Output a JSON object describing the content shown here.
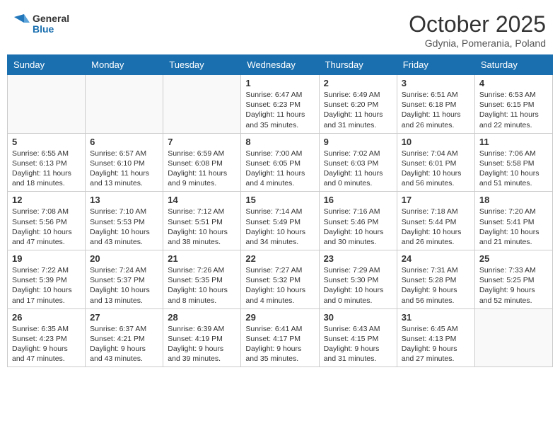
{
  "header": {
    "logo_general": "General",
    "logo_blue": "Blue",
    "month": "October 2025",
    "location": "Gdynia, Pomerania, Poland"
  },
  "weekdays": [
    "Sunday",
    "Monday",
    "Tuesday",
    "Wednesday",
    "Thursday",
    "Friday",
    "Saturday"
  ],
  "weeks": [
    [
      {
        "day": "",
        "info": ""
      },
      {
        "day": "",
        "info": ""
      },
      {
        "day": "",
        "info": ""
      },
      {
        "day": "1",
        "info": "Sunrise: 6:47 AM\nSunset: 6:23 PM\nDaylight: 11 hours\nand 35 minutes."
      },
      {
        "day": "2",
        "info": "Sunrise: 6:49 AM\nSunset: 6:20 PM\nDaylight: 11 hours\nand 31 minutes."
      },
      {
        "day": "3",
        "info": "Sunrise: 6:51 AM\nSunset: 6:18 PM\nDaylight: 11 hours\nand 26 minutes."
      },
      {
        "day": "4",
        "info": "Sunrise: 6:53 AM\nSunset: 6:15 PM\nDaylight: 11 hours\nand 22 minutes."
      }
    ],
    [
      {
        "day": "5",
        "info": "Sunrise: 6:55 AM\nSunset: 6:13 PM\nDaylight: 11 hours\nand 18 minutes."
      },
      {
        "day": "6",
        "info": "Sunrise: 6:57 AM\nSunset: 6:10 PM\nDaylight: 11 hours\nand 13 minutes."
      },
      {
        "day": "7",
        "info": "Sunrise: 6:59 AM\nSunset: 6:08 PM\nDaylight: 11 hours\nand 9 minutes."
      },
      {
        "day": "8",
        "info": "Sunrise: 7:00 AM\nSunset: 6:05 PM\nDaylight: 11 hours\nand 4 minutes."
      },
      {
        "day": "9",
        "info": "Sunrise: 7:02 AM\nSunset: 6:03 PM\nDaylight: 11 hours\nand 0 minutes."
      },
      {
        "day": "10",
        "info": "Sunrise: 7:04 AM\nSunset: 6:01 PM\nDaylight: 10 hours\nand 56 minutes."
      },
      {
        "day": "11",
        "info": "Sunrise: 7:06 AM\nSunset: 5:58 PM\nDaylight: 10 hours\nand 51 minutes."
      }
    ],
    [
      {
        "day": "12",
        "info": "Sunrise: 7:08 AM\nSunset: 5:56 PM\nDaylight: 10 hours\nand 47 minutes."
      },
      {
        "day": "13",
        "info": "Sunrise: 7:10 AM\nSunset: 5:53 PM\nDaylight: 10 hours\nand 43 minutes."
      },
      {
        "day": "14",
        "info": "Sunrise: 7:12 AM\nSunset: 5:51 PM\nDaylight: 10 hours\nand 38 minutes."
      },
      {
        "day": "15",
        "info": "Sunrise: 7:14 AM\nSunset: 5:49 PM\nDaylight: 10 hours\nand 34 minutes."
      },
      {
        "day": "16",
        "info": "Sunrise: 7:16 AM\nSunset: 5:46 PM\nDaylight: 10 hours\nand 30 minutes."
      },
      {
        "day": "17",
        "info": "Sunrise: 7:18 AM\nSunset: 5:44 PM\nDaylight: 10 hours\nand 26 minutes."
      },
      {
        "day": "18",
        "info": "Sunrise: 7:20 AM\nSunset: 5:41 PM\nDaylight: 10 hours\nand 21 minutes."
      }
    ],
    [
      {
        "day": "19",
        "info": "Sunrise: 7:22 AM\nSunset: 5:39 PM\nDaylight: 10 hours\nand 17 minutes."
      },
      {
        "day": "20",
        "info": "Sunrise: 7:24 AM\nSunset: 5:37 PM\nDaylight: 10 hours\nand 13 minutes."
      },
      {
        "day": "21",
        "info": "Sunrise: 7:26 AM\nSunset: 5:35 PM\nDaylight: 10 hours\nand 8 minutes."
      },
      {
        "day": "22",
        "info": "Sunrise: 7:27 AM\nSunset: 5:32 PM\nDaylight: 10 hours\nand 4 minutes."
      },
      {
        "day": "23",
        "info": "Sunrise: 7:29 AM\nSunset: 5:30 PM\nDaylight: 10 hours\nand 0 minutes."
      },
      {
        "day": "24",
        "info": "Sunrise: 7:31 AM\nSunset: 5:28 PM\nDaylight: 9 hours\nand 56 minutes."
      },
      {
        "day": "25",
        "info": "Sunrise: 7:33 AM\nSunset: 5:25 PM\nDaylight: 9 hours\nand 52 minutes."
      }
    ],
    [
      {
        "day": "26",
        "info": "Sunrise: 6:35 AM\nSunset: 4:23 PM\nDaylight: 9 hours\nand 47 minutes."
      },
      {
        "day": "27",
        "info": "Sunrise: 6:37 AM\nSunset: 4:21 PM\nDaylight: 9 hours\nand 43 minutes."
      },
      {
        "day": "28",
        "info": "Sunrise: 6:39 AM\nSunset: 4:19 PM\nDaylight: 9 hours\nand 39 minutes."
      },
      {
        "day": "29",
        "info": "Sunrise: 6:41 AM\nSunset: 4:17 PM\nDaylight: 9 hours\nand 35 minutes."
      },
      {
        "day": "30",
        "info": "Sunrise: 6:43 AM\nSunset: 4:15 PM\nDaylight: 9 hours\nand 31 minutes."
      },
      {
        "day": "31",
        "info": "Sunrise: 6:45 AM\nSunset: 4:13 PM\nDaylight: 9 hours\nand 27 minutes."
      },
      {
        "day": "",
        "info": ""
      }
    ]
  ]
}
